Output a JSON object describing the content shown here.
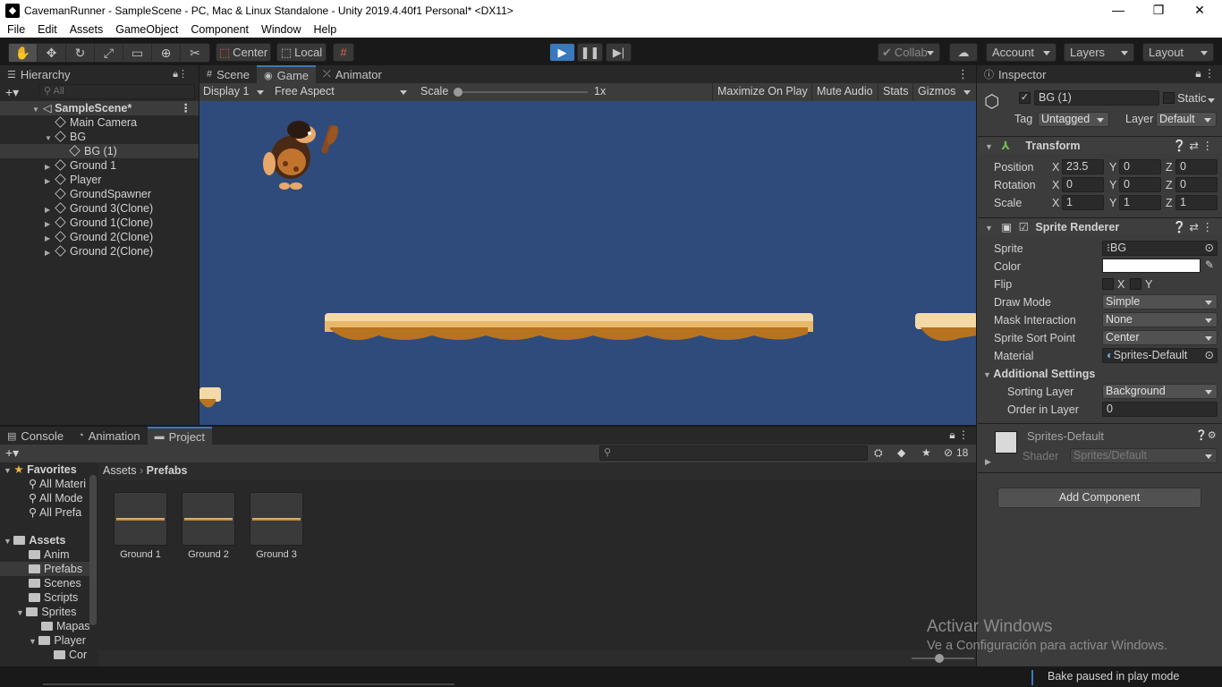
{
  "window": {
    "title": "CavemanRunner - SampleScene - PC, Mac & Linux Standalone - Unity 2019.4.40f1 Personal* <DX11>",
    "minimize": "—",
    "restore": "❐",
    "close": "✕"
  },
  "menu": [
    "File",
    "Edit",
    "Assets",
    "GameObject",
    "Component",
    "Window",
    "Help"
  ],
  "toolbar": {
    "pivot": "Center",
    "space": "Local",
    "collab": "Collab",
    "account": "Account",
    "layers": "Layers",
    "layout": "Layout"
  },
  "hierarchy": {
    "tab": "Hierarchy",
    "search_placeholder": "All",
    "scene": "SampleScene*",
    "items": [
      "Main Camera",
      "BG",
      "BG (1)",
      "Ground 1",
      "Player",
      "GroundSpawner",
      "Ground 3(Clone)",
      "Ground 1(Clone)",
      "Ground 2(Clone)",
      "Ground 2(Clone)"
    ]
  },
  "scene_tabs": [
    "Scene",
    "Game",
    "Animator"
  ],
  "game_bar": {
    "display": "Display 1",
    "aspect": "Free Aspect",
    "scale_label": "Scale",
    "scale_value": "1x",
    "maximize": "Maximize On Play",
    "mute": "Mute Audio",
    "stats": "Stats",
    "gizmos": "Gizmos"
  },
  "bottom_tabs": [
    "Console",
    "Animation",
    "Project"
  ],
  "project": {
    "count": "18",
    "breadcrumb": [
      "Assets",
      "Prefabs"
    ],
    "favorites_label": "Favorites",
    "favorites": [
      "All Materi",
      "All Mode",
      "All Prefa"
    ],
    "assets_label": "Assets",
    "folders": [
      "Anim",
      "Prefabs",
      "Scenes",
      "Scripts",
      "Sprites",
      "Mapas",
      "Player",
      "Cor"
    ],
    "prefabs": [
      "Ground 1",
      "Ground 2",
      "Ground 3"
    ]
  },
  "inspector": {
    "tab": "Inspector",
    "object_name": "BG (1)",
    "static": "Static",
    "tag_label": "Tag",
    "tag": "Untagged",
    "layer_label": "Layer",
    "layer": "Default",
    "transform": {
      "title": "Transform",
      "position_label": "Position",
      "position": [
        "23.5",
        "0",
        "0"
      ],
      "rotation_label": "Rotation",
      "rotation": [
        "0",
        "0",
        "0"
      ],
      "scale_label": "Scale",
      "scale": [
        "1",
        "1",
        "1"
      ]
    },
    "sprite_renderer": {
      "title": "Sprite Renderer",
      "sprite_label": "Sprite",
      "sprite": "BG",
      "color_label": "Color",
      "color": "#ffffff",
      "flip_label": "Flip",
      "flip_x": "X",
      "flip_y": "Y",
      "draw_mode_label": "Draw Mode",
      "draw_mode": "Simple",
      "mask_label": "Mask Interaction",
      "mask": "None",
      "sort_point_label": "Sprite Sort Point",
      "sort_point": "Center",
      "material_label": "Material",
      "material": "Sprites-Default",
      "additional": "Additional Settings",
      "sorting_layer_label": "Sorting Layer",
      "sorting_layer": "Background",
      "order_label": "Order in Layer",
      "order": "0"
    },
    "material_block": {
      "name": "Sprites-Default",
      "shader_label": "Shader",
      "shader": "Sprites/Default"
    },
    "add_component": "Add Component"
  },
  "watermark": {
    "line1": "Activar Windows",
    "line2": "Ve a Configuración para activar Windows."
  },
  "status": "Bake paused in play mode",
  "colors": {
    "game_bg": "#2f4b7c",
    "accent": "#3a79bb",
    "panel": "#282828"
  }
}
